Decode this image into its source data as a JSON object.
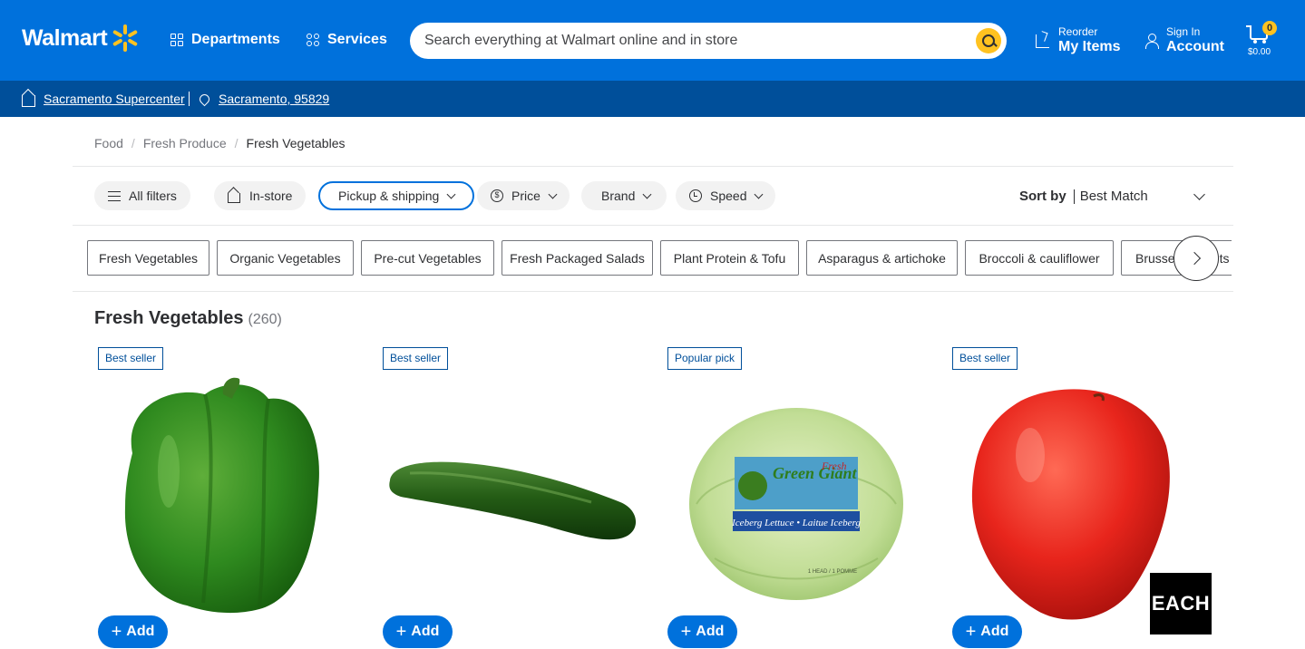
{
  "header": {
    "logo_text": "Walmart",
    "departments_label": "Departments",
    "services_label": "Services",
    "search_placeholder": "Search everything at Walmart online and in store",
    "reorder_small": "Reorder",
    "reorder_big": "My Items",
    "account_small": "Sign In",
    "account_big": "Account",
    "cart_count": "0",
    "cart_total": "$0.00",
    "brand_color": "#0071dc",
    "accent_color": "#ffc220"
  },
  "storebar": {
    "store": "Sacramento Supercenter",
    "location": "Sacramento, 95829"
  },
  "breadcrumb": {
    "items": [
      "Food",
      "Fresh Produce"
    ],
    "current": "Fresh Vegetables",
    "separator": "/"
  },
  "filters": {
    "all_filters": "All filters",
    "in_store": "In-store",
    "pickup": "Pickup & shipping",
    "price": "Price",
    "brand": "Brand",
    "speed": "Speed",
    "sort_label": "Sort by",
    "sort_value": "Best Match"
  },
  "chips": [
    "Fresh Vegetables",
    "Organic Vegetables",
    "Pre-cut Vegetables",
    "Fresh Packaged Salads",
    "Plant Protein & Tofu",
    "Asparagus & artichoke",
    "Broccoli & cauliflower",
    "Brussels sprouts &"
  ],
  "results": {
    "title": "Fresh Vegetables",
    "count": "(260)"
  },
  "products": [
    {
      "flag": "Best seller",
      "image": "green-bell-pepper",
      "add_label": "Add"
    },
    {
      "flag": "Best seller",
      "image": "cucumber",
      "add_label": "Add"
    },
    {
      "flag": "Popular pick",
      "image": "iceberg-lettuce",
      "add_label": "Add",
      "brand_text": "Green Giant",
      "brand_sub": "Fresh",
      "label_text": "Iceberg Lettuce • Laitue Iceberg",
      "pack_text": "1 HEAD / 1 POMME"
    },
    {
      "flag": "Best seller",
      "image": "roma-tomato",
      "add_label": "Add"
    }
  ],
  "overlay": {
    "each_label": "EACH"
  }
}
